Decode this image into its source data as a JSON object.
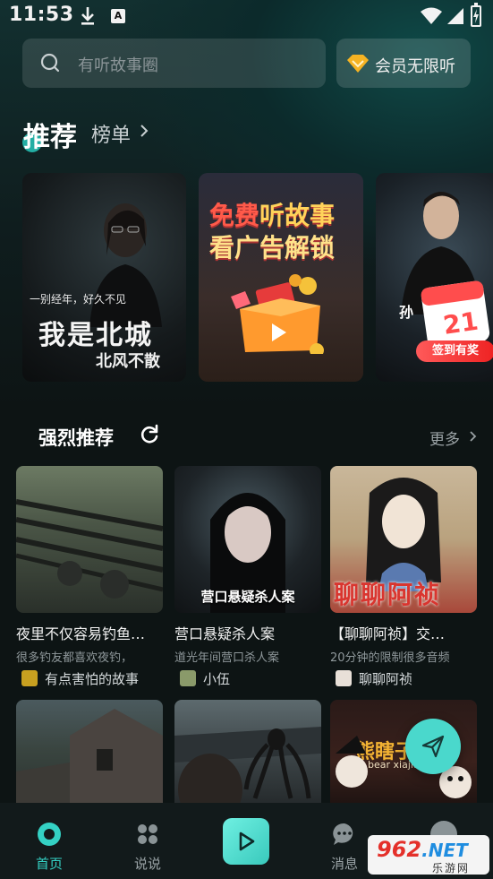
{
  "status_bar": {
    "time": "11:53",
    "a_badge": "A"
  },
  "search": {
    "placeholder": "有听故事圈",
    "icon": "search-icon"
  },
  "vip": {
    "label": "会员无限听",
    "icon": "diamond-icon",
    "accent": "#f5b323"
  },
  "tabs": {
    "recommend": "推荐",
    "ranking": "榜单"
  },
  "banners": [
    {
      "caption": "一别经年，好久不见",
      "title": "我是北城",
      "subtitle": "北风不散"
    },
    {
      "line1_red": "免费",
      "line1_rest": "听故事",
      "line2": "看广告解锁"
    },
    {
      "char": "孙",
      "badge": "签到有奖",
      "calendar_day": "21"
    }
  ],
  "section": {
    "title": "强烈推荐",
    "more": "更多"
  },
  "cards": [
    {
      "title": "夜里不仅容易钓鱼…",
      "desc": "很多钓友都喜欢夜钓，",
      "author": "有点害怕的故事",
      "image_caption": ""
    },
    {
      "title": "营口悬疑杀人案",
      "desc": "道光年间营口杀人案",
      "author": "小伍",
      "image_caption": "营口悬疑杀人案"
    },
    {
      "title": "【聊聊阿祯】交…",
      "desc": "20分钟的限制很多音频",
      "author": "聊聊阿祯",
      "image_caption": "聊聊阿祯"
    }
  ],
  "cards_row2": [
    {
      "image_caption": ""
    },
    {
      "image_caption": ""
    },
    {
      "title_art": "熊瞎子",
      "sub_art": "bear xiajia"
    }
  ],
  "nav": [
    {
      "label": "首页",
      "icon": "home-icon",
      "active": true
    },
    {
      "label": "说说",
      "icon": "clover-icon",
      "active": false
    },
    {
      "label": "",
      "icon": "play-icon",
      "active": false
    },
    {
      "label": "消息",
      "icon": "message-icon",
      "active": false
    }
  ],
  "watermark": {
    "brand": "962",
    "domain": ".NET",
    "sub": "乐游网"
  },
  "colors": {
    "accent": "#34d1c4",
    "background": "#0d1414"
  }
}
